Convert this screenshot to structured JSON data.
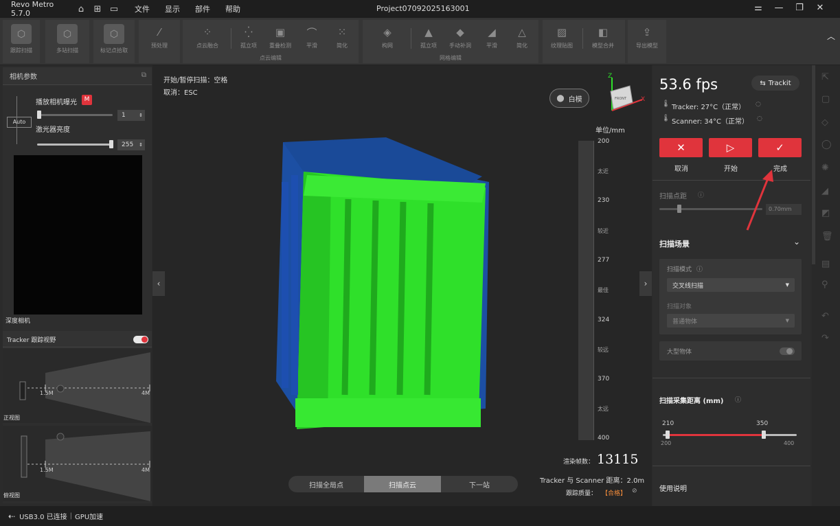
{
  "app": {
    "title": "Revo Metro 5.7.0",
    "project": "Project07092025163001",
    "menu": [
      "文件",
      "显示",
      "部件",
      "帮助"
    ]
  },
  "toolbar": {
    "scan_buttons": [
      "跟踪扫描",
      "多站扫描",
      "标记点拾取"
    ],
    "preprocess": "预处理",
    "point_cloud_buttons": [
      "点云融合",
      "孤立项",
      "重叠检测",
      "平滑",
      "简化"
    ],
    "point_cloud_group": "点云编辑",
    "mesh_buttons": [
      "构网",
      "孤立项",
      "手动补洞",
      "平滑",
      "简化"
    ],
    "mesh_group": "网格编辑",
    "texture": "纹理贴图",
    "merge": "模型合并",
    "export": "导出模型"
  },
  "left": {
    "camera_params": "相机参数",
    "exposure_label": "播放相机曝光",
    "exposure_value": "1",
    "laser_label": "激光器亮度",
    "laser_value": "255",
    "auto": "Auto",
    "badge": "M",
    "preview_label": "深度相机",
    "tracker_label": "Tracker 跟踪视野",
    "view1_label": "正视图",
    "view2_label": "俯视图",
    "near": "1.5M",
    "far": "4M"
  },
  "viewport": {
    "hint_start": "开始/暂停扫描：空格",
    "hint_cancel": "取消：ESC",
    "white_model": "白模",
    "unit": "单位/mm",
    "ruler_labels": [
      "200",
      "太近",
      "230",
      "较近",
      "277",
      "最佳",
      "324",
      "较远",
      "370",
      "太远",
      "400"
    ],
    "frame_label": "渲染帧数：",
    "frame_count": "13115",
    "distance": "Tracker 与 Scanner 距离：2.0m",
    "quality_label": "跟踪质量：",
    "quality_value": "【合格】",
    "tabs": [
      "扫描全局点",
      "扫描点云",
      "下一站"
    ],
    "cube_label": "FRONT"
  },
  "right": {
    "fps": "53.6 fps",
    "trackit": "Trackit",
    "tracker_temp": "Tracker: 27°C（正常）",
    "scanner_temp": "Scanner: 34°C（正常）",
    "cancel": "取消",
    "start": "开始",
    "finish": "完成",
    "point_distance_label": "扫描点距",
    "point_distance_value": "0.70mm",
    "scene_title": "扫描场景",
    "mode_label": "扫描模式",
    "mode_value": "交叉线扫描",
    "object_label": "扫描对象",
    "object_value": "普通物体",
    "large_object": "大型物体",
    "distance_title": "扫描采集距离 (mm)",
    "range_low": "210",
    "range_high": "350",
    "range_min": "200",
    "range_max": "400",
    "instructions": "使用说明"
  },
  "status": {
    "usb": "USB3.0 已连接",
    "gpu": "GPU加速"
  },
  "colors": {
    "accent": "#e0343c",
    "model_green": "#2fe02a",
    "model_blue": "#1e55b0"
  }
}
